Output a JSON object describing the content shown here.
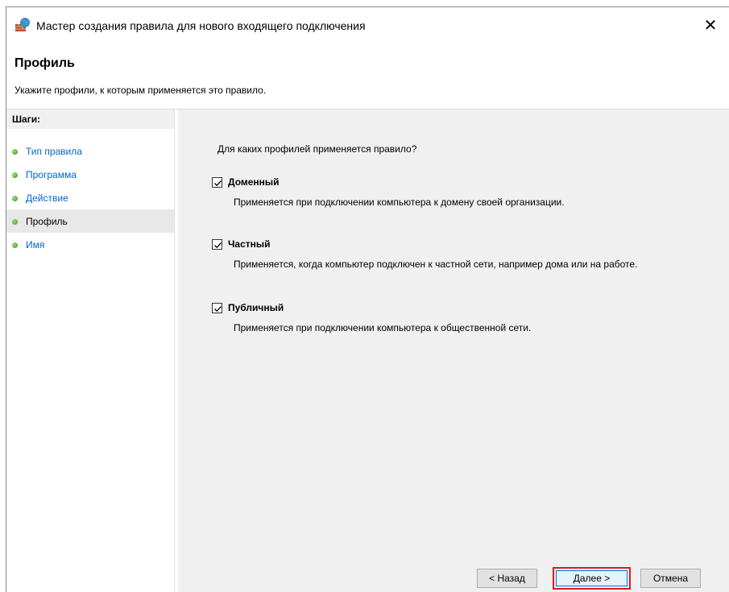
{
  "window": {
    "title": "Мастер создания правила для нового входящего подключения",
    "close_glyph": "✕",
    "icon": "firewall-icon"
  },
  "header": {
    "title": "Профиль",
    "subtitle": "Укажите профили, к которым применяется это правило."
  },
  "sidebar": {
    "title": "Шаги:",
    "items": [
      {
        "label": "Тип правила",
        "active": false
      },
      {
        "label": "Программа",
        "active": false
      },
      {
        "label": "Действие",
        "active": false
      },
      {
        "label": "Профиль",
        "active": true
      },
      {
        "label": "Имя",
        "active": false
      }
    ]
  },
  "main": {
    "question": "Для каких профилей применяется правило?",
    "profiles": [
      {
        "name": "Доменный",
        "checked": true,
        "description": "Применяется при подключении компьютера к домену своей организации."
      },
      {
        "name": "Частный",
        "checked": true,
        "description": "Применяется, когда компьютер подключен к частной сети, например дома или на работе."
      },
      {
        "name": "Публичный",
        "checked": true,
        "description": "Применяется при подключении компьютера к общественной сети."
      }
    ]
  },
  "buttons": {
    "back": "< Назад",
    "next": "Далее >",
    "cancel": "Отмена"
  },
  "colors": {
    "link": "#0066cc",
    "highlight_border": "#e0191c",
    "content_bg": "#f0f0f0"
  }
}
